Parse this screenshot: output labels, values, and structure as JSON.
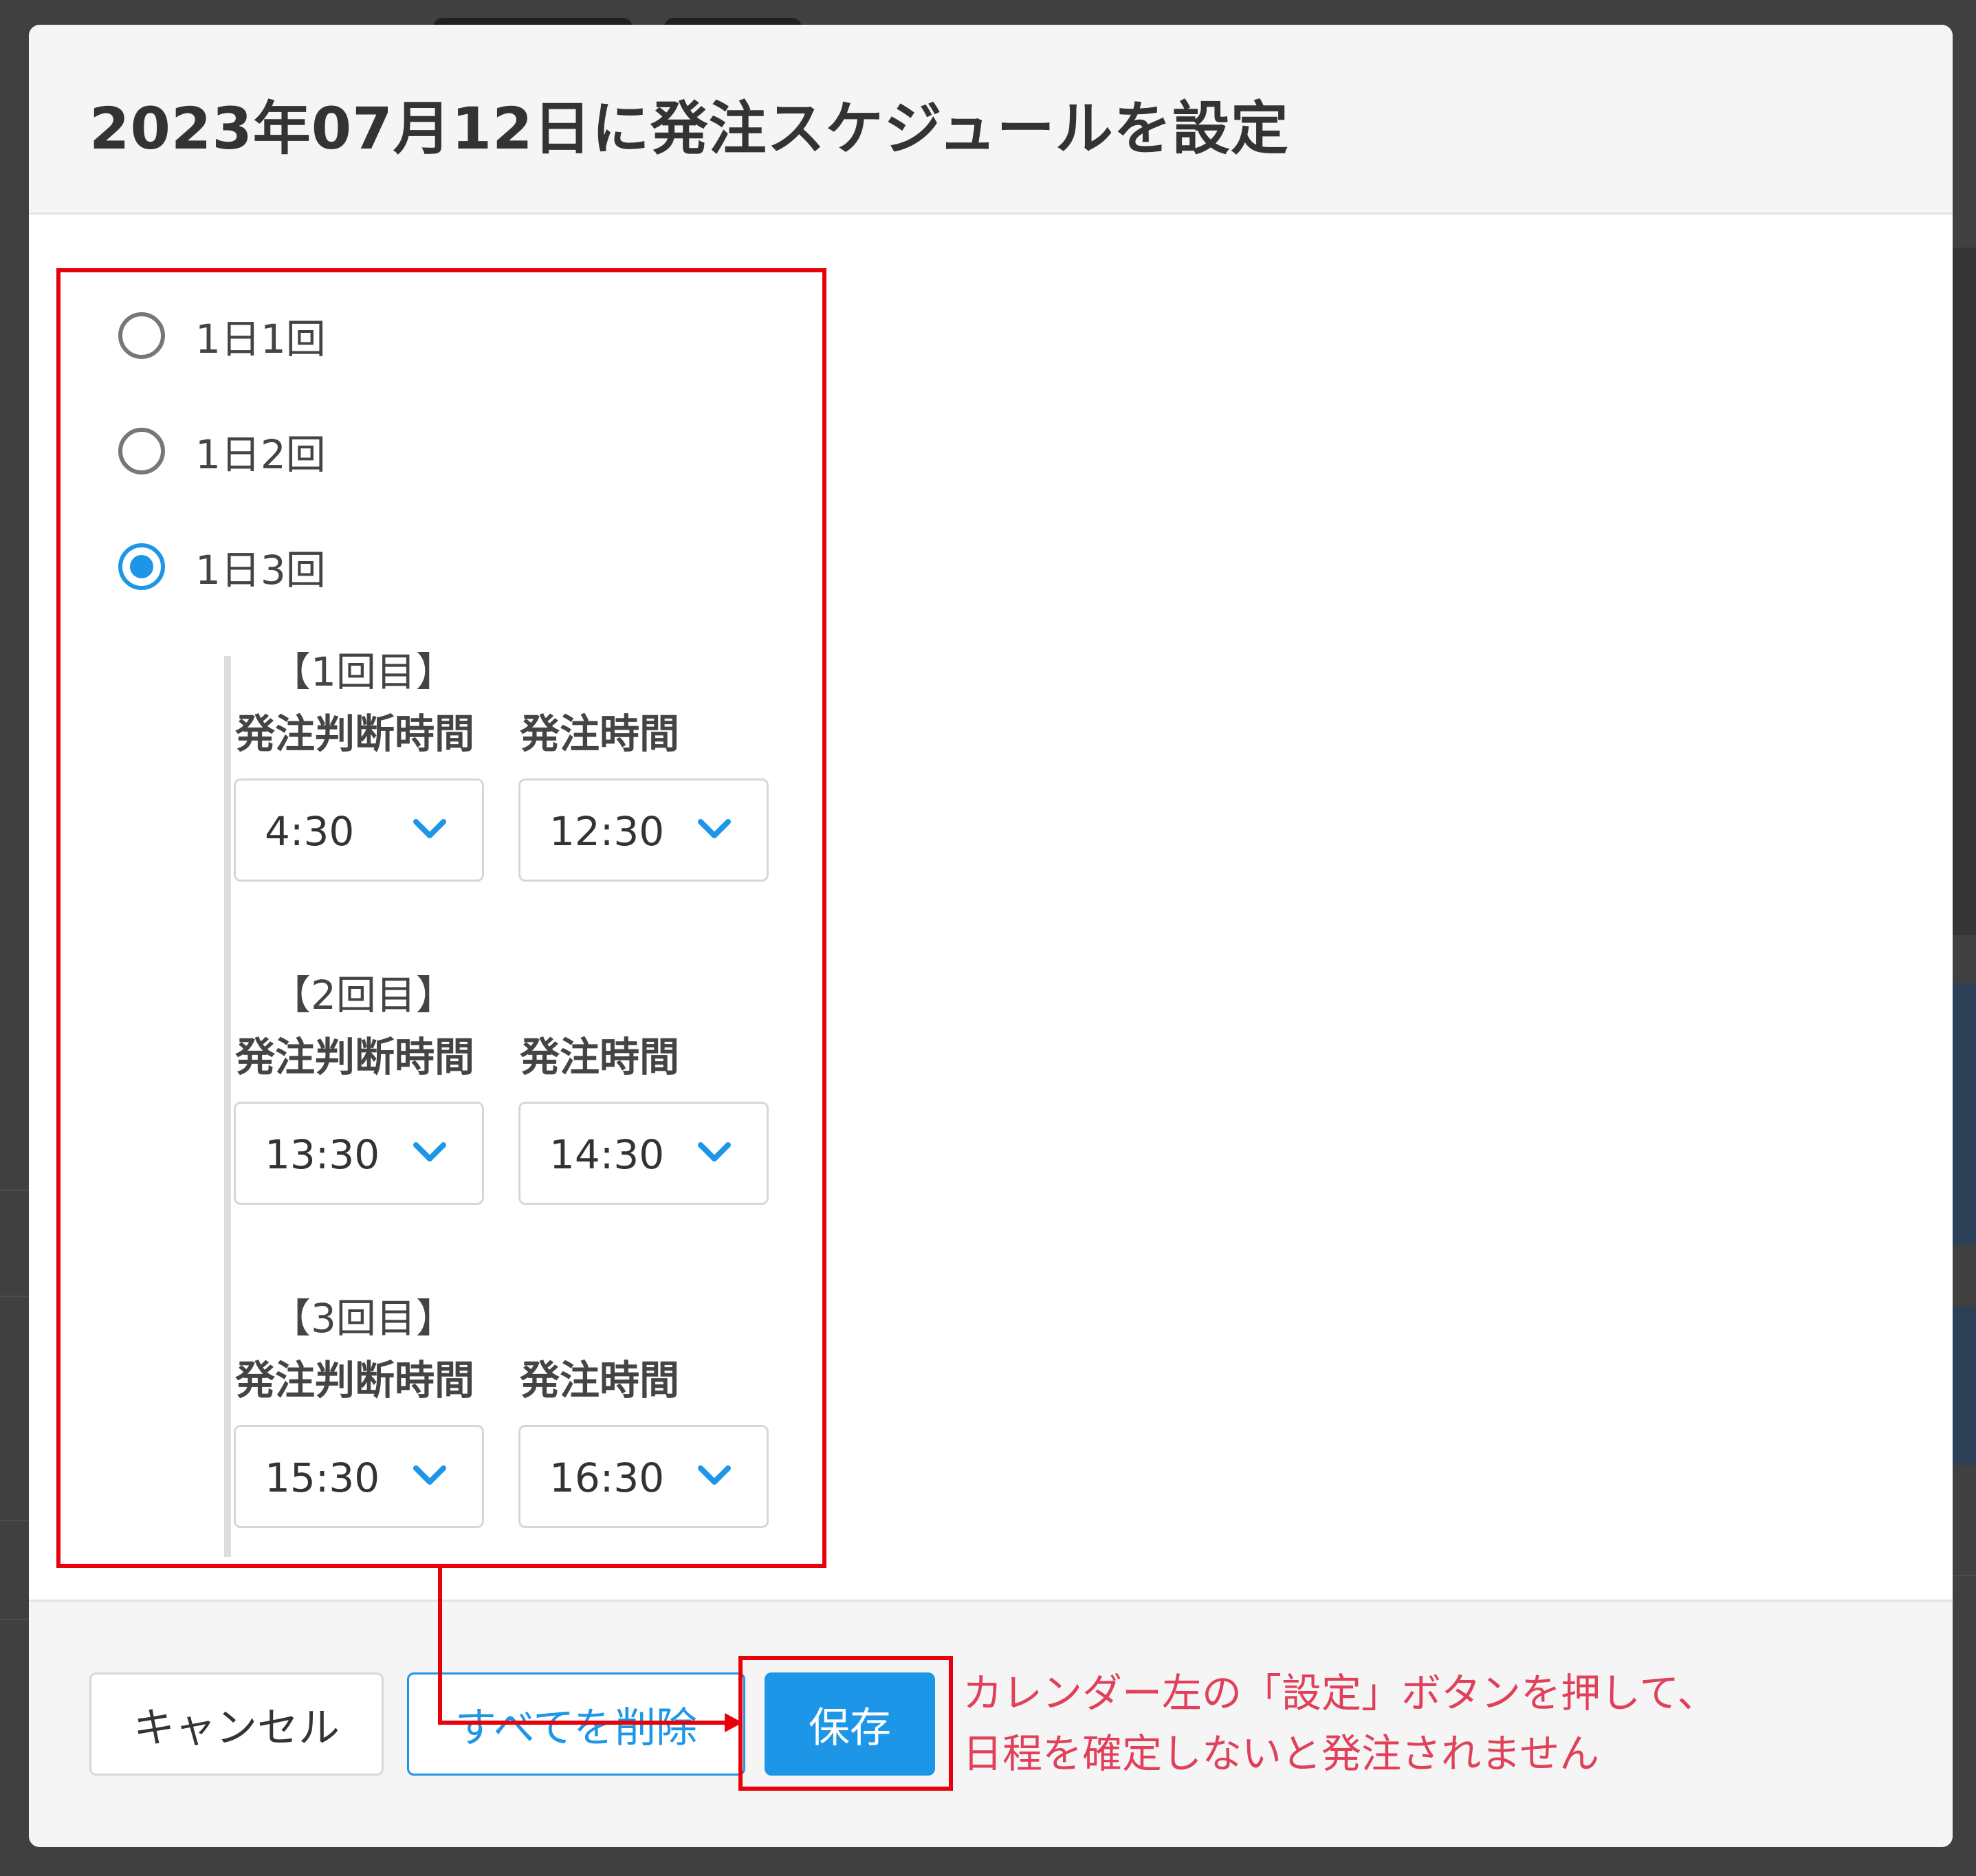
{
  "modal": {
    "title": "2023年07月12日に発注スケジュールを設定"
  },
  "frequency_options": [
    {
      "label": "1日1回",
      "selected": false
    },
    {
      "label": "1日2回",
      "selected": false
    },
    {
      "label": "1日3回",
      "selected": true
    }
  ],
  "field_labels": {
    "decision_time": "発注判断時間",
    "order_time": "発注時間"
  },
  "rounds": [
    {
      "title": "【1回目】",
      "decision_time": "4:30",
      "order_time": "12:30"
    },
    {
      "title": "【2回目】",
      "decision_time": "13:30",
      "order_time": "14:30"
    },
    {
      "title": "【3回目】",
      "decision_time": "15:30",
      "order_time": "16:30"
    }
  ],
  "footer": {
    "cancel_label": "キャンセル",
    "delete_all_label": "すべてを削除",
    "save_label": "保存"
  },
  "annotation": {
    "note_line1": "カレンダー左の「設定」ボタンを押して、",
    "note_line2": "日程を確定しないと発注されません"
  },
  "colors": {
    "accent": "#1e96e8",
    "annotation_red": "#e8000b",
    "annotation_text": "#e0405a"
  },
  "icons": {
    "select_chevron": "chevron-down-icon"
  }
}
